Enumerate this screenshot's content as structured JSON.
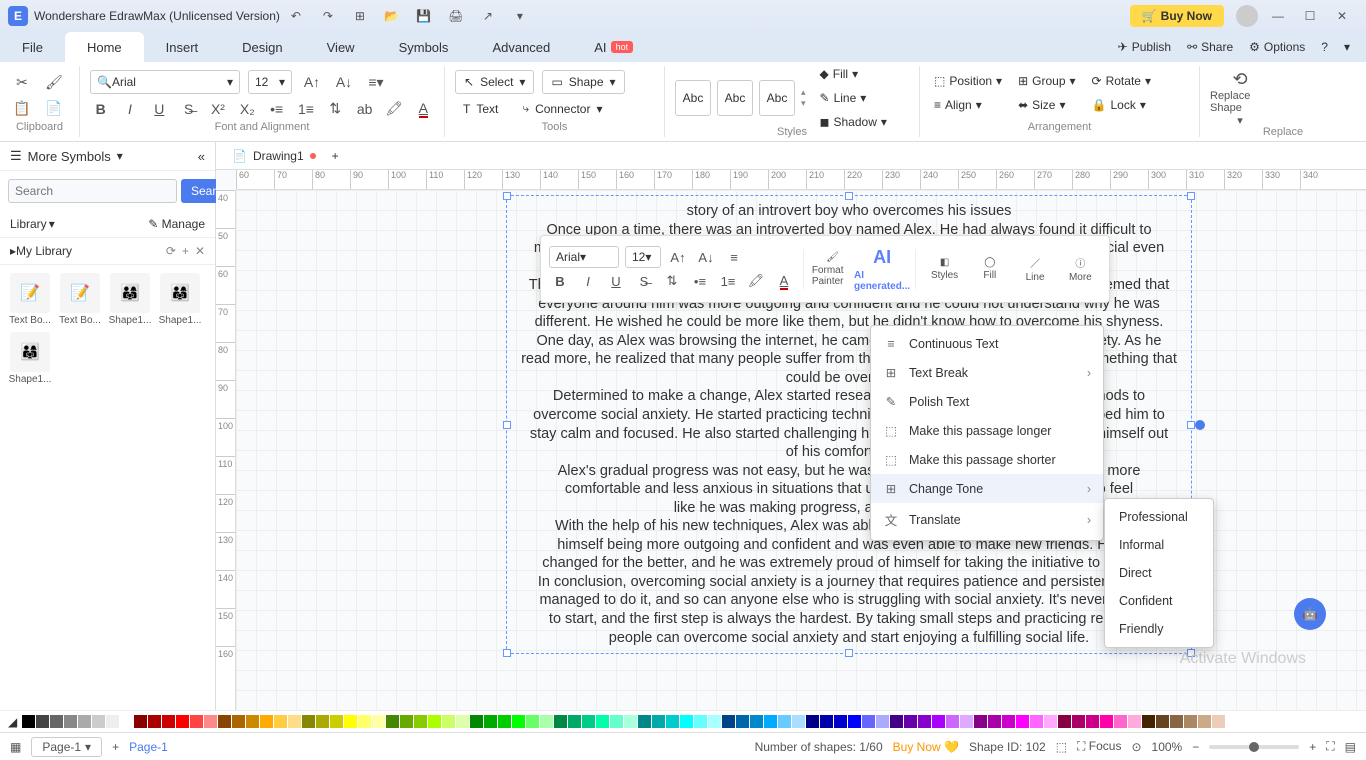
{
  "app": {
    "title": "Wondershare EdrawMax (Unlicensed Version)",
    "buy_now": "Buy Now"
  },
  "header": {
    "publish": "Publish",
    "share": "Share",
    "options": "Options"
  },
  "menu": {
    "file": "File",
    "home": "Home",
    "insert": "Insert",
    "design": "Design",
    "view": "View",
    "symbols": "Symbols",
    "advanced": "Advanced",
    "ai": "AI",
    "hot": "hot"
  },
  "ribbon": {
    "clipboard": "Clipboard",
    "font_align": "Font and Alignment",
    "tools": "Tools",
    "styles": "Styles",
    "arrangement": "Arrangement",
    "replace": "Replace",
    "font_name": "Arial",
    "font_size": "12",
    "select": "Select",
    "shape": "Shape",
    "text": "Text",
    "connector": "Connector",
    "abc": "Abc",
    "fill": "Fill",
    "line": "Line",
    "shadow": "Shadow",
    "position": "Position",
    "align": "Align",
    "group": "Group",
    "size": "Size",
    "rotate": "Rotate",
    "lock": "Lock",
    "replace_shape": "Replace Shape"
  },
  "sidebar": {
    "more": "More Symbols",
    "search_ph": "Search",
    "search_btn": "Search",
    "library": "Library",
    "manage": "Manage",
    "my_lib": "My Library",
    "thumbs": [
      "Text Bo...",
      "Text Bo...",
      "Shape1...",
      "Shape1...",
      "Shape1..."
    ]
  },
  "doc": {
    "tab": "Drawing1",
    "body": "story of an introvert boy who overcomes his issues\nOnce upon a time, there was an introverted boy named Alex. He had always found it difficult to\nmake friends and connect with people. He preferred to stay in his own world and avoid social even\nts.\nThis made Alex feel isolated and alone, and he often wondered why he was different. It seemed that\neveryone around him was more outgoing and confident and he could not understand why he was\ndifferent. He wished he could be more like them, but he didn't know how to overcome his shyness.\nOne day, as Alex was browsing the internet, he came across an article about social anxiety. As he\nread more, he realized that many people suffer from the same condition and that it was something that\ncould be overcome.\nDetermined to make a change, Alex started researching different techniques and methods to\novercome social anxiety. He started practicing techniques like deep breathing, which helped him to\nstay calm and focused. He also started challenging himself to talk to strangers and push himself out\nof his comfort zone.\nAlex's gradual progress was not easy, but he was persistent. He slowly started to feel more\ncomfortable and less anxious in situations that used to overwhelm him. He started to feel\nlike he was making progress, and his confidence grew.\nWith the help of his new techniques, Alex was able to overcome his social anxiety. He found\nhimself being more outgoing and confident and was even able to make new friends. His life\nchanged for the better, and he was extremely proud of himself for taking the initiative to change.\nIn conclusion, overcoming social anxiety is a journey that requires patience and persistence. Alex\nmanaged to do it, and so can anyone else who is struggling with social anxiety. It's never too late\nto start, and the first step is always the hardest. By taking small steps and practicing regularly,\npeople can overcome social anxiety and start enjoying a fulfilling social life."
  },
  "float": {
    "font": "Arial",
    "size": "12",
    "format_painter": "Format Painter",
    "ai": "AI generated...",
    "styles": "Styles",
    "fill": "Fill",
    "line": "Line",
    "more": "More"
  },
  "ctx": {
    "cont": "Continuous Text",
    "break": "Text Break",
    "polish": "Polish Text",
    "longer": "Make this passage longer",
    "shorter": "Make this passage shorter",
    "tone": "Change Tone",
    "translate": "Translate"
  },
  "tone": {
    "prof": "Professional",
    "inf": "Informal",
    "dir": "Direct",
    "conf": "Confident",
    "fri": "Friendly"
  },
  "status": {
    "page": "Page-1",
    "page_tab": "Page-1",
    "shapes": "Number of shapes: 1/60",
    "buy": "Buy Now",
    "shape_id": "Shape ID: 102",
    "focus": "Focus",
    "zoom": "100%"
  },
  "watermark": "Activate Windows",
  "ruler_h": [
    "60",
    "70",
    "80",
    "90",
    "100",
    "110",
    "120",
    "130",
    "140",
    "150",
    "160",
    "170",
    "180",
    "190",
    "200",
    "210",
    "220",
    "230",
    "240",
    "250",
    "260",
    "270",
    "280",
    "290",
    "300",
    "310",
    "320",
    "330",
    "340"
  ],
  "ruler_v": [
    "40",
    "50",
    "60",
    "70",
    "80",
    "90",
    "100",
    "110",
    "120",
    "130",
    "140",
    "150",
    "160"
  ],
  "colors": [
    "#000",
    "#444",
    "#666",
    "#888",
    "#aaa",
    "#ccc",
    "#eee",
    "#fff",
    "#800",
    "#a00",
    "#c00",
    "#f00",
    "#f44",
    "#f88",
    "#840",
    "#a60",
    "#c80",
    "#fa0",
    "#fc4",
    "#fd8",
    "#880",
    "#aa0",
    "#cc0",
    "#ff0",
    "#ff6",
    "#ffa",
    "#480",
    "#6a0",
    "#8c0",
    "#af0",
    "#cf6",
    "#dfa",
    "#080",
    "#0a0",
    "#0c0",
    "#0f0",
    "#6f6",
    "#afa",
    "#084",
    "#0a6",
    "#0c8",
    "#0fa",
    "#6fc",
    "#afd",
    "#088",
    "#0aa",
    "#0cc",
    "#0ff",
    "#6ff",
    "#aff",
    "#048",
    "#06a",
    "#08c",
    "#0af",
    "#6cf",
    "#adf",
    "#008",
    "#00a",
    "#00c",
    "#00f",
    "#66f",
    "#aaf",
    "#408",
    "#60a",
    "#80c",
    "#a0f",
    "#c6f",
    "#daf",
    "#808",
    "#a0a",
    "#c0c",
    "#f0f",
    "#f6f",
    "#faf",
    "#804",
    "#a06",
    "#c08",
    "#f0a",
    "#f6c",
    "#fad",
    "#420",
    "#642",
    "#864",
    "#a86",
    "#ca8",
    "#ecb"
  ]
}
